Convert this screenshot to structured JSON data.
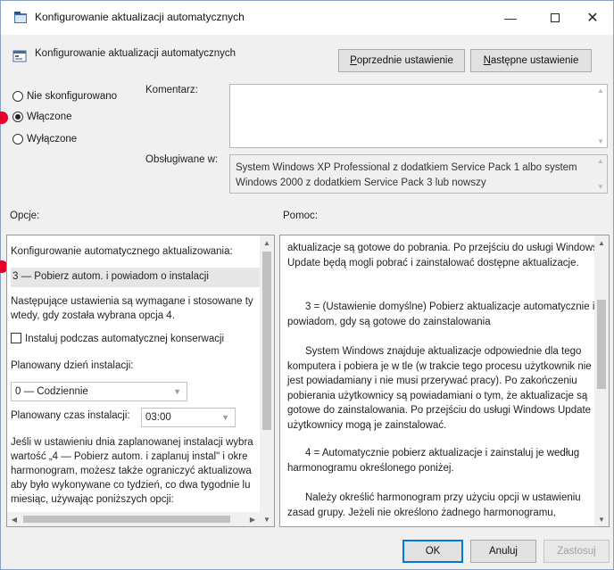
{
  "window": {
    "title": "Konfigurowanie aktualizacji automatycznych",
    "min_glyph": "—",
    "close_glyph": "✕"
  },
  "header": {
    "setting_name": "Konfigurowanie aktualizacji automatycznych",
    "prev_label": "Poprzednie ustawienie",
    "prev_accel": "P",
    "prev_rest": "oprzednie ustawienie",
    "next_label": "Następne ustawienie",
    "next_accel": "N",
    "next_rest": "astępne ustawienie"
  },
  "state": {
    "options": [
      {
        "label": "Nie skonfigurowano",
        "selected": false
      },
      {
        "label": "Włączone",
        "selected": true
      },
      {
        "label": "Wyłączone",
        "selected": false
      }
    ]
  },
  "comment": {
    "label": "Komentarz:",
    "value": ""
  },
  "supported": {
    "label": "Obsługiwane w:",
    "value": "System Windows XP Professional z dodatkiem Service Pack 1 albo system Windows 2000 z dodatkiem Service Pack 3 lub nowszy"
  },
  "options_panel": {
    "heading": "Opcje:",
    "configure_label": "Konfigurowanie automatycznego aktualizowania:",
    "configure_value": "3 — Pobierz autom. i powiadom o instalacji",
    "required_note_1": "Następujące ustawienia są wymagane i stosowane ty",
    "required_note_2": "wtedy, gdy została wybrana opcja 4.",
    "maintenance_checkbox": "Instaluj podczas automatycznej konserwacji",
    "maintenance_checked": false,
    "day_label": "Planowany dzień instalacji:",
    "day_value": "0 — Codziennie",
    "time_label": "Planowany czas instalacji:",
    "time_value": "03:00",
    "para_lines": [
      "Jeśli w ustawieniu dnia zaplanowanej instalacji wybra",
      "wartość „4 — Pobierz autom. i zaplanuj instal\" i okre",
      "harmonogram, możesz także ograniczyć aktualizowa",
      "aby było wykonywane co tydzień, co dwa tygodnie lu",
      "miesiąc, używając poniższych opcji:"
    ]
  },
  "help_panel": {
    "heading": "Pomoc:",
    "paragraphs": [
      "aktualizacje są gotowe do pobrania. Po przejściu do usługi Windows Update będą mogli pobrać i zainstalować dostępne aktualizacje.",
      "3 = (Ustawienie domyślne) Pobierz aktualizacje automatycznie i powiadom, gdy są gotowe do zainstalowania",
      "System Windows znajduje aktualizacje odpowiednie dla tego komputera i pobiera je w tle (w trakcie tego procesu użytkownik nie jest powiadamiany i nie musi przerywać pracy). Po zakończeniu pobierania użytkownicy są powiadamiani o tym, że aktualizacje są gotowe do zainstalowania. Po przejściu do usługi Windows Update użytkownicy mogą je zainstalować.",
      "4 = Automatycznie pobierz aktualizacje i zainstaluj je według harmonogramu określonego poniżej.",
      "Należy określić harmonogram przy użyciu opcji w ustawieniu zasad grupy. Jeżeli nie określono żadnego harmonogramu,"
    ]
  },
  "footer": {
    "ok": "OK",
    "cancel": "Anuluj",
    "apply": "Zastosuj"
  },
  "colors": {
    "annotation_marker": "#e4002b",
    "primary_border": "#0078d7"
  },
  "icons": {
    "title": "policy-window-icon",
    "setting": "policy-setting-icon"
  }
}
